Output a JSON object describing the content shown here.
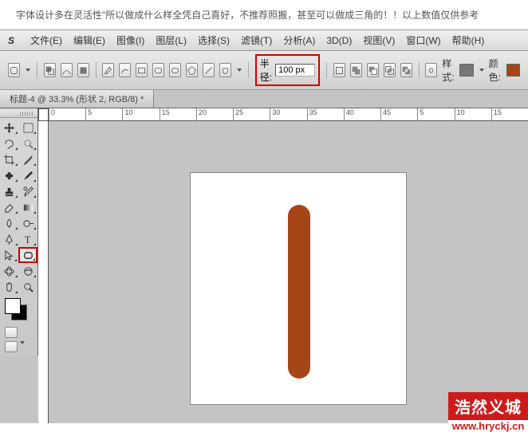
{
  "top_note": "字体设计多在灵活性\"所以做成什么样全凭自己喜好，不推荐照搬，甚至可以做成三角的！！以上数值仅供参考",
  "menu": {
    "ps": "S",
    "file": "文件(E)",
    "edit": "编辑(E)",
    "image": "图像(I)",
    "layer": "图层(L)",
    "select": "选择(S)",
    "filter": "滤镜(T)",
    "analysis": "分析(A)",
    "threed": "3D(D)",
    "view": "视图(V)",
    "window": "窗口(W)",
    "help": "帮助(H)"
  },
  "options": {
    "radius_label": "半径:",
    "radius_value": "100 px",
    "style_label": "样式:",
    "color_label": "颜色:",
    "color_value": "#a64616",
    "style_swatch": "#777"
  },
  "tab": "标题-4 @ 33.3% (形状 2, RGB/8) *",
  "ruler_ticks": [
    "0",
    "5",
    "10",
    "15",
    "20",
    "25",
    "30",
    "35",
    "40",
    "45",
    "5",
    "10",
    "15"
  ],
  "shape_color": "#a64616",
  "watermark": {
    "title": "浩然义城",
    "url": "www.hryckj.cn"
  }
}
